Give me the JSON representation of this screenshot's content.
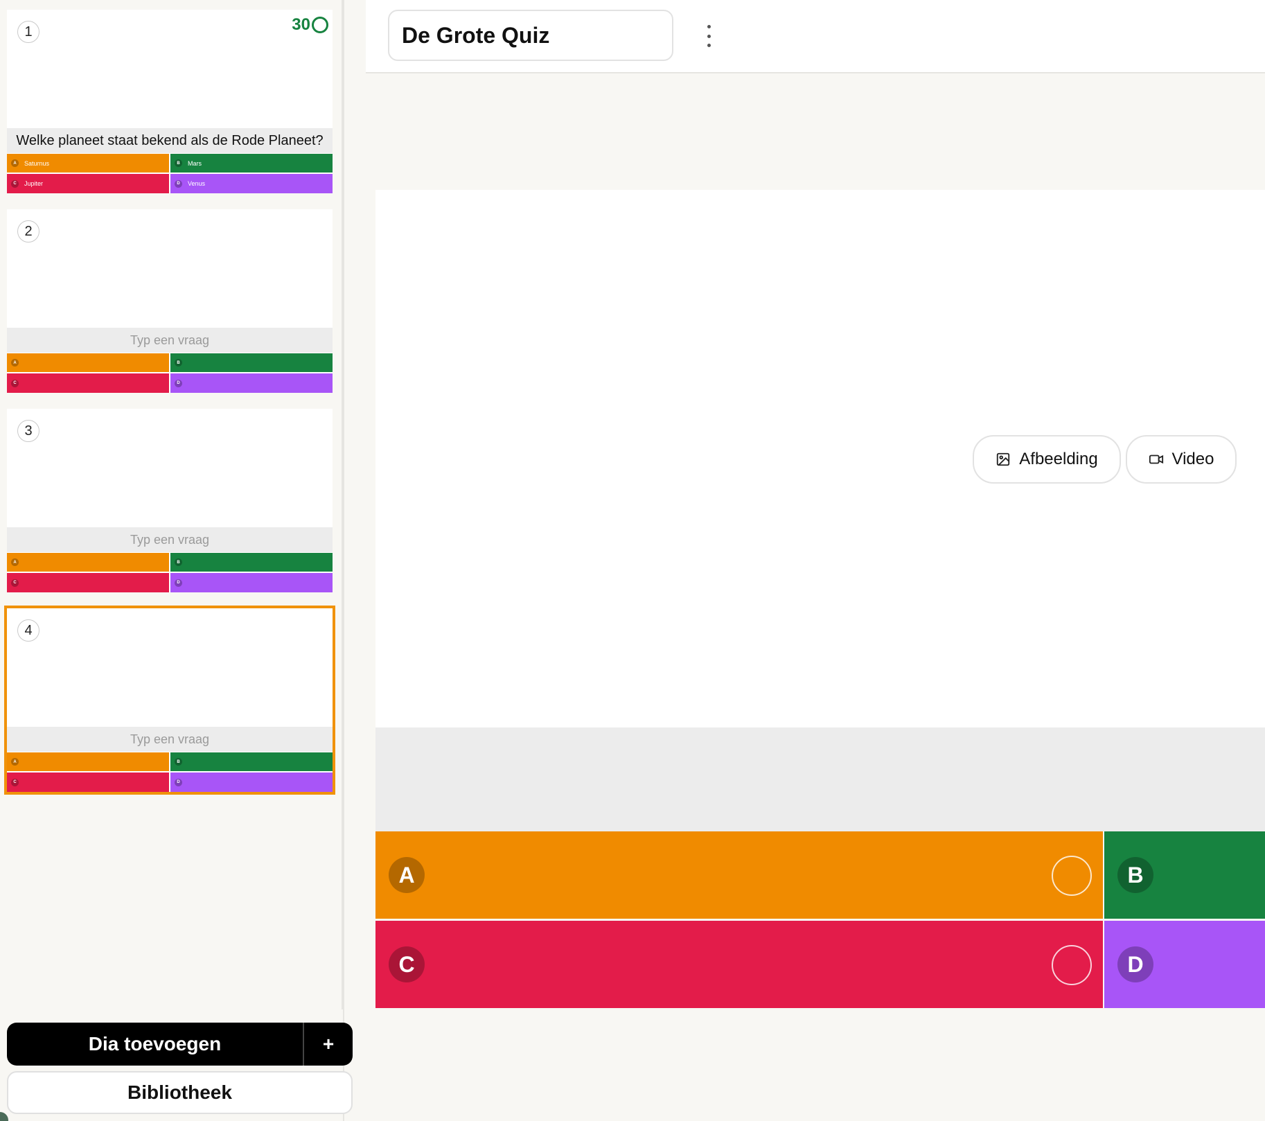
{
  "colors": {
    "a": "#f08b00",
    "b": "#178340",
    "c": "#e31c4a",
    "d": "#a855f7",
    "accent": "#f0920a"
  },
  "header": {
    "title": "De Grote Quiz",
    "more_icon": "more-vertical-icon"
  },
  "slides": [
    {
      "number": "1",
      "timer": "30",
      "question": "Welke planeet staat bekend als de Rode Planeet?",
      "answers": [
        "Saturnus",
        "Mars",
        "Jupiter",
        "Venus"
      ]
    },
    {
      "number": "2",
      "question_placeholder": "Typ een vraag"
    },
    {
      "number": "3",
      "question_placeholder": "Typ een vraag"
    },
    {
      "number": "4",
      "question_placeholder": "Typ een vraag"
    }
  ],
  "answer_letters": [
    "A",
    "B",
    "C",
    "D"
  ],
  "footer": {
    "add_slide": "Dia toevoegen",
    "add_plus": "+",
    "library": "Bibliotheek"
  },
  "editor": {
    "image_button": "Afbeelding",
    "video_button": "Video"
  }
}
